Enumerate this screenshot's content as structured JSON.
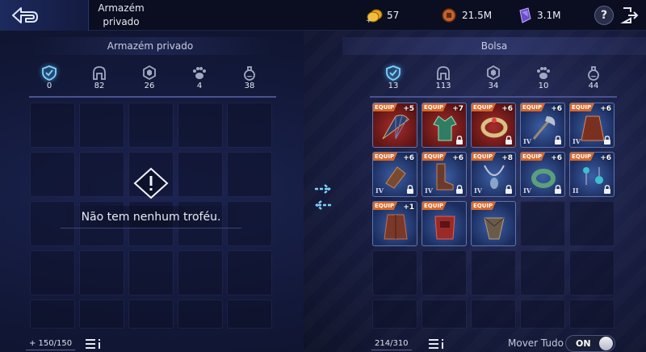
{
  "topbar": {
    "title": "Armazém privado",
    "currencies": [
      {
        "name": "gold-coins-icon",
        "value": "57"
      },
      {
        "name": "copper-coin-icon",
        "value": "21.5M"
      },
      {
        "name": "crystal-icon",
        "value": "3.1M"
      }
    ],
    "help_label": "?"
  },
  "left_panel": {
    "title": "Armazém privado",
    "categories": [
      {
        "icon": "shield-icon",
        "count": "0"
      },
      {
        "icon": "helmet-icon",
        "count": "82"
      },
      {
        "icon": "hexagon-gem-icon",
        "count": "26"
      },
      {
        "icon": "paw-icon",
        "count": "4"
      },
      {
        "icon": "potion-icon",
        "count": "38"
      }
    ],
    "empty_message": "Não tem nenhum troféu.",
    "capacity": "+ 150/150"
  },
  "right_panel": {
    "title": "Bolsa",
    "categories": [
      {
        "icon": "shield-icon",
        "count": "13"
      },
      {
        "icon": "helmet-icon",
        "count": "113"
      },
      {
        "icon": "hexagon-gem-icon",
        "count": "34"
      },
      {
        "icon": "paw-icon",
        "count": "10"
      },
      {
        "icon": "potion-icon",
        "count": "44"
      }
    ],
    "items": [
      {
        "name": "fan",
        "badge": "EQUIP",
        "plus": "+5",
        "tier": "",
        "locked": false,
        "rarity": "red"
      },
      {
        "name": "robe",
        "badge": "EQUIP",
        "plus": "+7",
        "tier": "",
        "locked": true,
        "rarity": "red"
      },
      {
        "name": "bracelet",
        "badge": "EQUIP",
        "plus": "+6",
        "tier": "",
        "locked": true,
        "rarity": "red"
      },
      {
        "name": "axe",
        "badge": "EQUIP",
        "plus": "+6",
        "tier": "IV",
        "locked": true,
        "rarity": "blue"
      },
      {
        "name": "cape",
        "badge": "EQUIP",
        "plus": "+6",
        "tier": "IV",
        "locked": true,
        "rarity": "blue"
      },
      {
        "name": "gauntlet",
        "badge": "EQUIP",
        "plus": "+6",
        "tier": "IV",
        "locked": true,
        "rarity": "blue"
      },
      {
        "name": "boots",
        "badge": "EQUIP",
        "plus": "+6",
        "tier": "IV",
        "locked": true,
        "rarity": "blue"
      },
      {
        "name": "necklace",
        "badge": "EQUIP",
        "plus": "+8",
        "tier": "IV",
        "locked": true,
        "rarity": "blue"
      },
      {
        "name": "ring",
        "badge": "EQUIP",
        "plus": "+6",
        "tier": "IV",
        "locked": true,
        "rarity": "blue"
      },
      {
        "name": "earrings",
        "badge": "EQUIP",
        "plus": "+6",
        "tier": "II",
        "locked": true,
        "rarity": "blue"
      },
      {
        "name": "coat",
        "badge": "EQUIP",
        "plus": "+1",
        "tier": "",
        "locked": false,
        "rarity": "blue"
      },
      {
        "name": "chestplate",
        "badge": "EQUIP",
        "plus": "",
        "tier": "",
        "locked": false,
        "rarity": "blue"
      },
      {
        "name": "greaves",
        "badge": "EQUIP",
        "plus": "",
        "tier": "",
        "locked": false,
        "rarity": "blue"
      }
    ],
    "capacity": "214/310",
    "mover_label": "Mover Tudo",
    "toggle_label": "ON"
  },
  "colors": {
    "equip_badge": "#d7682a",
    "active_category": "#4fc3ff",
    "transfer_arrow": "#7fd3ff"
  }
}
